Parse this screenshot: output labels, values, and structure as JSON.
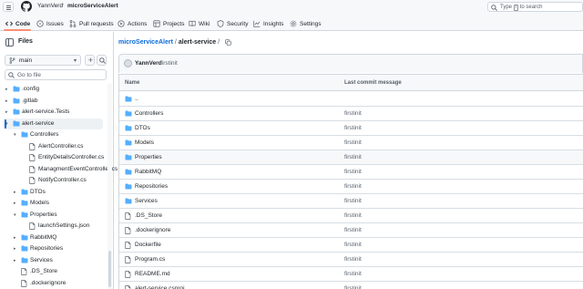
{
  "header": {
    "owner": "YannVerd",
    "separator": "/",
    "repo": "microServiceAlert",
    "search_placeholder": "Type / to search",
    "search_before": "Type",
    "search_key": "/",
    "search_after": "to search"
  },
  "tabs": [
    {
      "label": "Code",
      "icon": "code-icon"
    },
    {
      "label": "Issues",
      "icon": "issue-icon"
    },
    {
      "label": "Pull requests",
      "icon": "pull-request-icon"
    },
    {
      "label": "Actions",
      "icon": "play-icon"
    },
    {
      "label": "Projects",
      "icon": "table-icon"
    },
    {
      "label": "Wiki",
      "icon": "book-icon"
    },
    {
      "label": "Security",
      "icon": "shield-icon"
    },
    {
      "label": "Insights",
      "icon": "graph-icon"
    },
    {
      "label": "Settings",
      "icon": "gear-icon"
    }
  ],
  "sidebar": {
    "title": "Files",
    "branch": "main",
    "goto_placeholder": "Go to file",
    "tree": [
      {
        "label": ".config",
        "type": "folder",
        "level": 0,
        "expanded": false
      },
      {
        "label": ".gitlab",
        "type": "folder",
        "level": 0,
        "expanded": false
      },
      {
        "label": "alert-service.Tests",
        "type": "folder",
        "level": 0,
        "expanded": false
      },
      {
        "label": "alert-service",
        "type": "folder",
        "level": 0,
        "expanded": true,
        "selected": true
      },
      {
        "label": "Controllers",
        "type": "folder",
        "level": 1,
        "expanded": true
      },
      {
        "label": "AlertController.cs",
        "type": "file",
        "level": 2
      },
      {
        "label": "EntityDetailsController.cs",
        "type": "file",
        "level": 2
      },
      {
        "label": "ManagmentEventController.cs",
        "type": "file",
        "level": 2
      },
      {
        "label": "NotifyController.cs",
        "type": "file",
        "level": 2
      },
      {
        "label": "DTOs",
        "type": "folder",
        "level": 1,
        "expanded": false
      },
      {
        "label": "Models",
        "type": "folder",
        "level": 1,
        "expanded": false
      },
      {
        "label": "Properties",
        "type": "folder",
        "level": 1,
        "expanded": true
      },
      {
        "label": "launchSettings.json",
        "type": "file",
        "level": 2
      },
      {
        "label": "RabbitMQ",
        "type": "folder",
        "level": 1,
        "expanded": false
      },
      {
        "label": "Repositories",
        "type": "folder",
        "level": 1,
        "expanded": false
      },
      {
        "label": "Services",
        "type": "folder",
        "level": 1,
        "expanded": false
      },
      {
        "label": ".DS_Store",
        "type": "file",
        "level": 1
      },
      {
        "label": ".dockerignore",
        "type": "file",
        "level": 1
      }
    ]
  },
  "main": {
    "breadcrumb": {
      "repo": "microServiceAlert",
      "sep": "/",
      "current": "alert-service",
      "trail": "/"
    },
    "commit": {
      "author": "YannVerd",
      "message": "firstinit"
    },
    "table": {
      "col_name": "Name",
      "col_commit": "Last commit message",
      "rows": [
        {
          "name": "..",
          "type": "folder",
          "message": ""
        },
        {
          "name": "Controllers",
          "type": "folder",
          "message": "firstinit"
        },
        {
          "name": "DTOs",
          "type": "folder",
          "message": "firstinit"
        },
        {
          "name": "Models",
          "type": "folder",
          "message": "firstinit"
        },
        {
          "name": "Properties",
          "type": "folder",
          "message": "firstinit",
          "hover": true
        },
        {
          "name": "RabbitMQ",
          "type": "folder",
          "message": "firstinit"
        },
        {
          "name": "Repositories",
          "type": "folder",
          "message": "firstinit"
        },
        {
          "name": "Services",
          "type": "folder",
          "message": "firstinit"
        },
        {
          "name": ".DS_Store",
          "type": "file",
          "message": "firstinit"
        },
        {
          "name": ".dockerignore",
          "type": "file",
          "message": "firstinit"
        },
        {
          "name": "Dockerfile",
          "type": "file",
          "message": "firstinit"
        },
        {
          "name": "Program.cs",
          "type": "file",
          "message": "firstinit"
        },
        {
          "name": "README.md",
          "type": "file",
          "message": "firstinit"
        },
        {
          "name": "alert-service.csproj",
          "type": "file",
          "message": "firstinit"
        }
      ]
    }
  },
  "colors": {
    "folder": "#54aeff",
    "link": "#0969da",
    "accent_underline": "#fd8c73",
    "muted": "#57606a",
    "border": "#d0d7de"
  }
}
